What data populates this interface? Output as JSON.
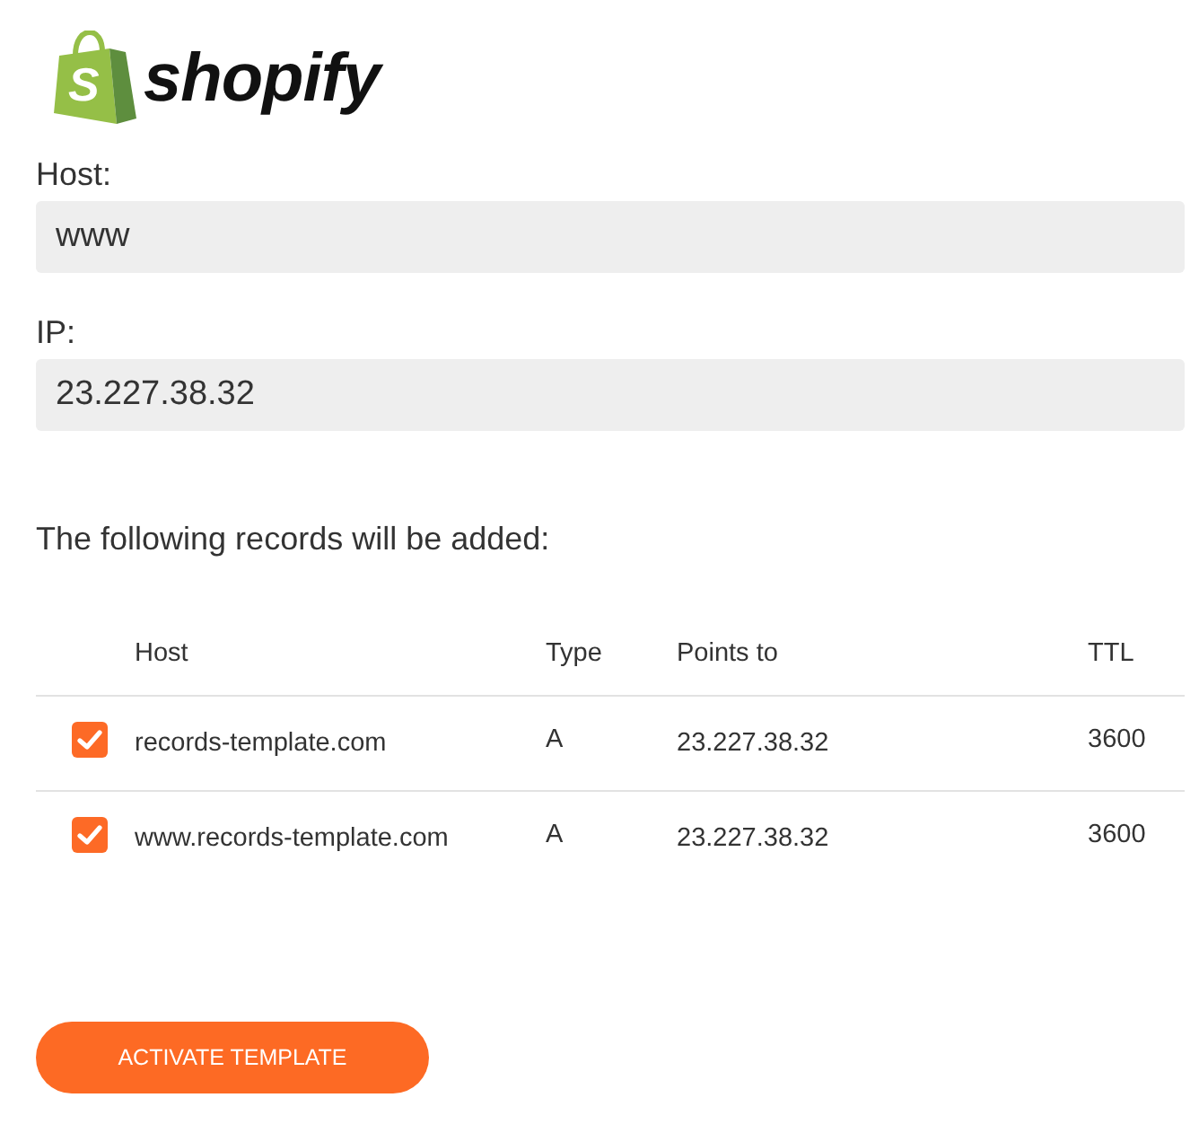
{
  "logo": {
    "letter": "S",
    "wordmark": "shopify"
  },
  "fields": [
    {
      "label": "Host:",
      "value": "www"
    },
    {
      "label": "IP:",
      "value": "23.227.38.32"
    }
  ],
  "records": {
    "intro": "The following records will be added:",
    "columns": [
      "Host",
      "Type",
      "Points to",
      "TTL"
    ],
    "rows": [
      {
        "checked": true,
        "cells": [
          "records-template.com",
          "A",
          "23.227.38.32",
          "3600"
        ]
      },
      {
        "checked": true,
        "cells": [
          "www.records-template.com",
          "A",
          "23.227.38.32",
          "3600"
        ]
      }
    ]
  },
  "button": {
    "label": "ACTIVATE TEMPLATE"
  }
}
